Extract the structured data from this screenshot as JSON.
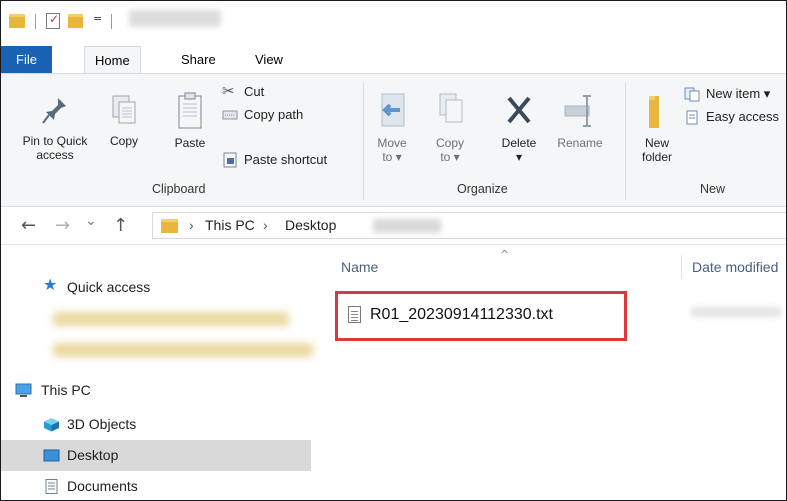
{
  "ribbon_tabs": {
    "file": "File",
    "home": "Home",
    "share": "Share",
    "view": "View"
  },
  "clipboard": {
    "pin_label_1": "Pin to Quick",
    "pin_label_2": "access",
    "copy": "Copy",
    "paste": "Paste",
    "cut": "Cut",
    "copy_path": "Copy path",
    "paste_shortcut": "Paste shortcut",
    "group_label": "Clipboard"
  },
  "organize": {
    "move_to_1": "Move",
    "move_to_2": "to ▾",
    "copy_to_1": "Copy",
    "copy_to_2": "to ▾",
    "delete": "Delete",
    "delete_arrow": "▾",
    "rename": "Rename",
    "group_label": "Organize"
  },
  "new_group": {
    "new_folder_1": "New",
    "new_folder_2": "folder",
    "new_item": "New item ▾",
    "easy_access": "Easy access",
    "group_label": "New"
  },
  "address": {
    "back": "←",
    "forward": "→",
    "recent": "⌄",
    "up": "↑",
    "sep1": "›",
    "this_pc": "This PC",
    "sep2": "›",
    "desktop": "Desktop"
  },
  "nav": {
    "quick_access": "Quick access",
    "this_pc": "This PC",
    "objects3d": "3D Objects",
    "desktop": "Desktop",
    "documents": "Documents"
  },
  "content": {
    "col_name": "Name",
    "col_date": "Date modified",
    "sort_caret": "^",
    "file_name": "R01_20230914112330.txt"
  },
  "colors": {
    "accent": "#1a62b4",
    "highlight_box": "#d9393a",
    "folder": "#e8b63c"
  }
}
